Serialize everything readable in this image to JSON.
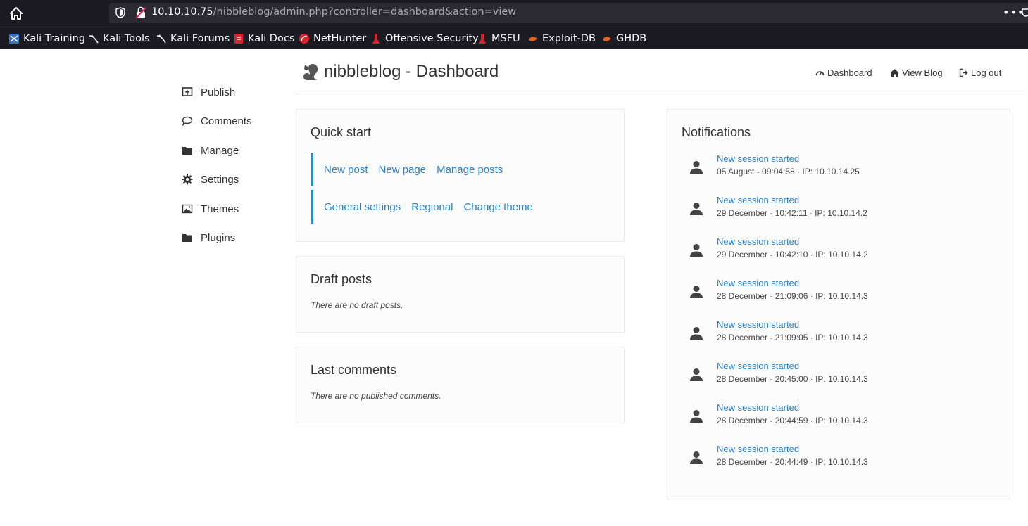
{
  "browser": {
    "url_host": "10.10.10.75",
    "url_path": "/nibbleblog/admin.php?controller=dashboard&action=view",
    "overflow_menu": "•••",
    "bookmarks": [
      {
        "label": "Kali Training",
        "icon": "kali-training-icon"
      },
      {
        "label": "Kali Tools",
        "icon": "kali-dragon-icon"
      },
      {
        "label": "Kali Forums",
        "icon": "kali-dragon-icon"
      },
      {
        "label": "Kali Docs",
        "icon": "kali-docs-icon"
      },
      {
        "label": "NetHunter",
        "icon": "nethunter-icon"
      },
      {
        "label": "Offensive Security",
        "icon": "offsec-icon"
      },
      {
        "label": "MSFU",
        "icon": "offsec-icon"
      },
      {
        "label": "Exploit-DB",
        "icon": "exploitdb-icon"
      },
      {
        "label": "GHDB",
        "icon": "exploitdb-icon"
      }
    ]
  },
  "header": {
    "title": "nibbleblog - Dashboard",
    "nav": {
      "dashboard": "Dashboard",
      "view_blog": "View Blog",
      "logout": "Log out"
    }
  },
  "sidebar": {
    "items": [
      {
        "label": "Publish",
        "icon": "publish-icon"
      },
      {
        "label": "Comments",
        "icon": "comment-icon"
      },
      {
        "label": "Manage",
        "icon": "folder-icon"
      },
      {
        "label": "Settings",
        "icon": "gear-icon"
      },
      {
        "label": "Themes",
        "icon": "image-icon"
      },
      {
        "label": "Plugins",
        "icon": "folder-icon"
      }
    ]
  },
  "quick_start": {
    "title": "Quick start",
    "row1": [
      "New post",
      "New page",
      "Manage posts"
    ],
    "row2": [
      "General settings",
      "Regional",
      "Change theme"
    ]
  },
  "draft_posts": {
    "title": "Draft posts",
    "empty": "There are no draft posts."
  },
  "last_comments": {
    "title": "Last comments",
    "empty": "There are no published comments."
  },
  "notifications": {
    "title": "Notifications",
    "items": [
      {
        "title": "New session started",
        "meta": "05 August - 09:04:58 · IP: 10.10.14.25"
      },
      {
        "title": "New session started",
        "meta": "29 December - 10:42:11 · IP: 10.10.14.2"
      },
      {
        "title": "New session started",
        "meta": "29 December - 10:42:10 · IP: 10.10.14.2"
      },
      {
        "title": "New session started",
        "meta": "28 December - 21:09:06 · IP: 10.10.14.3"
      },
      {
        "title": "New session started",
        "meta": "28 December - 21:09:05 · IP: 10.10.14.3"
      },
      {
        "title": "New session started",
        "meta": "28 December - 20:45:00 · IP: 10.10.14.3"
      },
      {
        "title": "New session started",
        "meta": "28 December - 20:44:59 · IP: 10.10.14.3"
      },
      {
        "title": "New session started",
        "meta": "28 December - 20:44:49 · IP: 10.10.14.3"
      }
    ]
  },
  "colors": {
    "link": "#2a82c7",
    "accent_bar": "#2c8fc0",
    "chrome_bg": "#1c1b22"
  }
}
